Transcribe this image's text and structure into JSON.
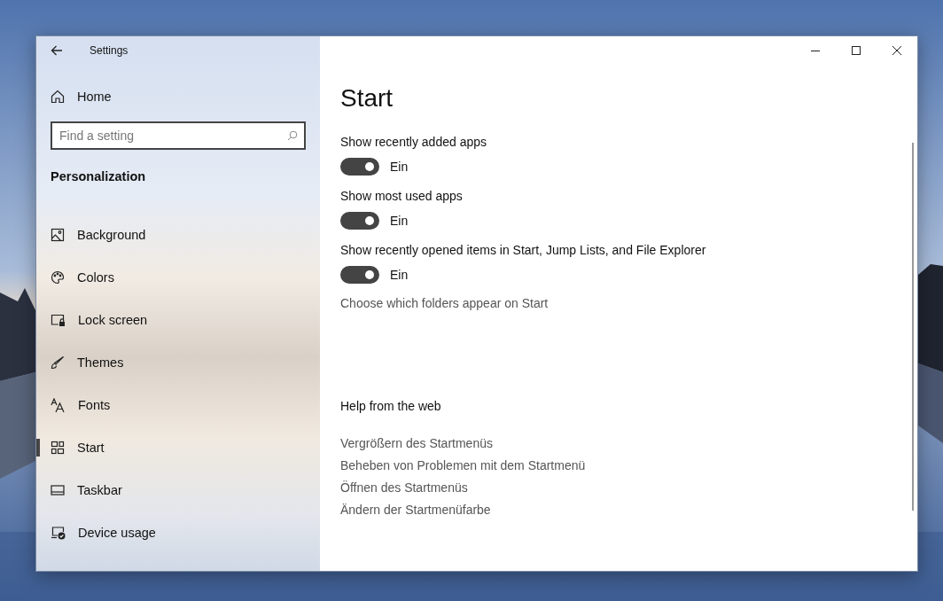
{
  "window": {
    "title": "Settings"
  },
  "sidebar": {
    "home": "Home",
    "search": {
      "placeholder": "Find a setting"
    },
    "section": "Personalization",
    "items": [
      {
        "label": "Background",
        "selected": false
      },
      {
        "label": "Colors",
        "selected": false
      },
      {
        "label": "Lock screen",
        "selected": false
      },
      {
        "label": "Themes",
        "selected": false
      },
      {
        "label": "Fonts",
        "selected": false
      },
      {
        "label": "Start",
        "selected": true
      },
      {
        "label": "Taskbar",
        "selected": false
      },
      {
        "label": "Device usage",
        "selected": false
      }
    ]
  },
  "content": {
    "title": "Start",
    "toggles": [
      {
        "label": "Show recently added apps",
        "on": true,
        "state_text": "Ein"
      },
      {
        "label": "Show most used apps",
        "on": true,
        "state_text": "Ein"
      },
      {
        "label": "Show recently opened items in Start, Jump Lists, and File Explorer",
        "on": true,
        "state_text": "Ein"
      }
    ],
    "folders_link": "Choose which folders appear on Start",
    "help": {
      "heading": "Help from the web",
      "links": [
        "Vergrößern des Startmenüs",
        "Beheben von Problemen mit dem Startmenü",
        "Öffnen des Startmenüs",
        "Ändern der Startmenüfarbe"
      ]
    }
  }
}
